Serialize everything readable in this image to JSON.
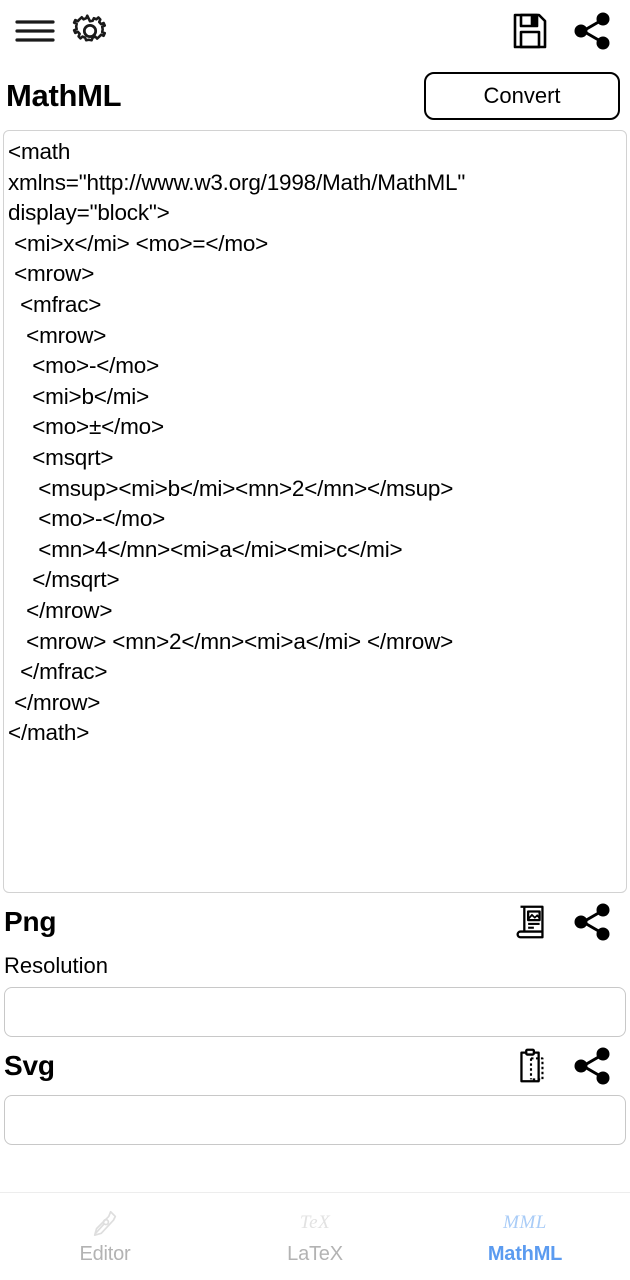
{
  "appbar": {
    "menu_icon": "hamburger-menu-icon",
    "settings_icon": "gear-icon",
    "save_icon": "floppy-disk-save-icon",
    "share_icon": "share-icon"
  },
  "header": {
    "title": "MathML",
    "convert_label": "Convert"
  },
  "editor": {
    "name": "mathml-source",
    "value": "<math\nxmlns=\"http://www.w3.org/1998/Math/MathML\"\ndisplay=\"block\">\n <mi>x</mi> <mo>=</mo>\n <mrow>\n  <mfrac>\n   <mrow>\n    <mo>-</mo>\n    <mi>b</mi>\n    <mo>±</mo>\n    <msqrt>\n     <msup><mi>b</mi><mn>2</mn></msup>\n     <mo>-</mo>\n     <mn>4</mn><mi>a</mi><mi>c</mi>\n    </msqrt>\n   </mrow>\n   <mrow> <mn>2</mn><mi>a</mi> </mrow>\n  </mfrac>\n </mrow>\n</math>",
    "placeholder": ""
  },
  "png_section": {
    "title": "Png",
    "save_icon": "save-to-gallery-icon",
    "share_icon": "share-icon",
    "resolution_label": "Resolution",
    "resolution_value": "",
    "resolution_placeholder": ""
  },
  "svg_section": {
    "title": "Svg",
    "copy_icon": "clipboard-copy-icon",
    "share_icon": "share-icon",
    "value": "",
    "placeholder": ""
  },
  "bottom_nav": {
    "items": [
      {
        "label": "Editor",
        "glyph": "",
        "icon": "pen-nib-icon",
        "active": false
      },
      {
        "label": "LaTeX",
        "glyph": "TeX",
        "icon": "tex-logo-icon",
        "active": false
      },
      {
        "label": "MathML",
        "glyph": "MML",
        "icon": "mml-logo-icon",
        "active": true
      }
    ]
  },
  "colors": {
    "accent": "#5b9bf0",
    "accent_muted": "#a9ccf7",
    "inactive": "#b3b3b3",
    "border": "#c8c8c8",
    "text": "#000000"
  }
}
